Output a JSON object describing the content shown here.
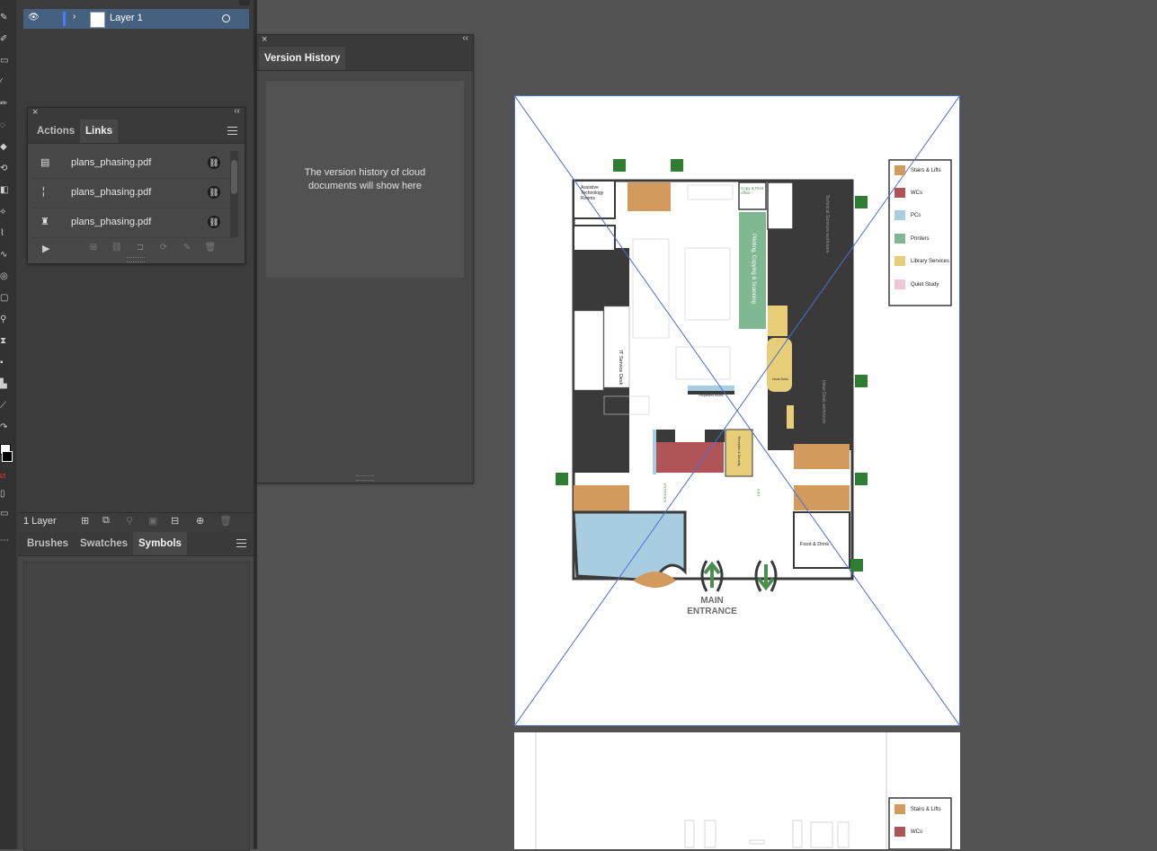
{
  "layers_panel": {
    "layer_name": "Layer 1",
    "count_label": "1 Layer"
  },
  "actions_links_panel": {
    "tabs": [
      "Actions",
      "Links"
    ],
    "active_tab": "Links",
    "links": [
      {
        "name": "plans_phasing.pdf"
      },
      {
        "name": "plans_phasing.pdf"
      },
      {
        "name": "plans_phasing.pdf"
      }
    ]
  },
  "version_history_panel": {
    "tab": "Version History",
    "message_line1": "The version history of cloud",
    "message_line2": "documents will show here"
  },
  "brushes_panel": {
    "tabs": [
      "Brushes",
      "Swatches",
      "Symbols"
    ],
    "active_tab": "Symbols"
  },
  "floorplan": {
    "main_entrance_line1": "MAIN",
    "main_entrance_line2": "ENTRANCE",
    "labels": {
      "assistive": "Assistive Technology Rooms",
      "printing": "Printing, Copying & Scanning",
      "copy_print": "Copy & Print office",
      "it_desk": "IT Service Desk",
      "food": "Food & Drink",
      "requested": "Requested Books",
      "issue": "Issue Desk",
      "tech_services": "Technical Services workroom",
      "issue_workroom": "Issue Desk workroom",
      "reception": "Reception & Security",
      "exit": "EXIT",
      "entrance": "ENTRANCE"
    },
    "legend": [
      {
        "label": "Stairs & Lifts",
        "color": "#d39a5e"
      },
      {
        "label": "WCs",
        "color": "#b15457"
      },
      {
        "label": "PCs",
        "color": "#a9cde0"
      },
      {
        "label": "Printers",
        "color": "#7fb893"
      },
      {
        "label": "Library Services",
        "color": "#e8cd79"
      },
      {
        "label": "Quiet Study",
        "color": "#efc6d8"
      }
    ],
    "legend_page2": [
      {
        "label": "Stairs & Lifts",
        "color": "#d39a5e"
      },
      {
        "label": "WCs",
        "color": "#b15457"
      }
    ]
  },
  "colors": {
    "selection_blue": "#4a6fd6",
    "layer_highlight": "#46607f",
    "exit_green": "#2e7d32",
    "walls": "#3a3a3a"
  }
}
